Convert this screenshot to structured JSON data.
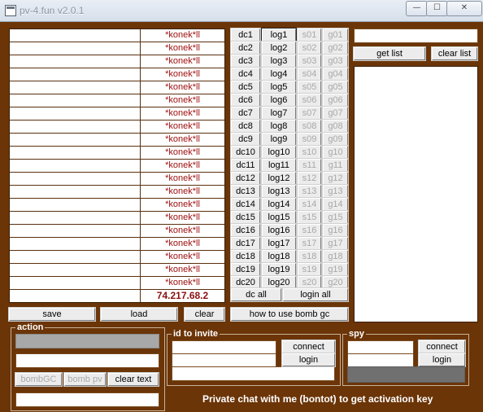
{
  "window": {
    "title": "pv-4.fun v2.0.1",
    "controls": {
      "minimize": "—",
      "maximize": "☐",
      "close": "✕"
    }
  },
  "rooms": {
    "rows": [
      {
        "name": "",
        "tag": "*konek*ll"
      },
      {
        "name": "",
        "tag": "*konek*ll"
      },
      {
        "name": "",
        "tag": "*konek*ll"
      },
      {
        "name": "",
        "tag": "*konek*ll"
      },
      {
        "name": "",
        "tag": "*konek*ll"
      },
      {
        "name": "",
        "tag": "*konek*ll"
      },
      {
        "name": "",
        "tag": "*konek*ll"
      },
      {
        "name": "",
        "tag": "*konek*ll"
      },
      {
        "name": "",
        "tag": "*konek*ll"
      },
      {
        "name": "",
        "tag": "*konek*ll"
      },
      {
        "name": "",
        "tag": "*konek*ll"
      },
      {
        "name": "",
        "tag": "*konek*ll"
      },
      {
        "name": "",
        "tag": "*konek*ll"
      },
      {
        "name": "",
        "tag": "*konek*ll"
      },
      {
        "name": "",
        "tag": "*konek*ll"
      },
      {
        "name": "",
        "tag": "*konek*ll"
      },
      {
        "name": "",
        "tag": "*konek*ll"
      },
      {
        "name": "",
        "tag": "*konek*ll"
      },
      {
        "name": "",
        "tag": "*konek*ll"
      },
      {
        "name": "",
        "tag": "*konek*ll"
      }
    ],
    "ip": "74.217.68.2"
  },
  "session_buttons": [
    {
      "dc": "dc1",
      "log": "log1",
      "s": "s01",
      "g": "g01"
    },
    {
      "dc": "dc2",
      "log": "log2",
      "s": "s02",
      "g": "g02"
    },
    {
      "dc": "dc3",
      "log": "log3",
      "s": "s03",
      "g": "g03"
    },
    {
      "dc": "dc4",
      "log": "log4",
      "s": "s04",
      "g": "g04"
    },
    {
      "dc": "dc5",
      "log": "log5",
      "s": "s05",
      "g": "g05"
    },
    {
      "dc": "dc6",
      "log": "log6",
      "s": "s06",
      "g": "g06"
    },
    {
      "dc": "dc7",
      "log": "log7",
      "s": "s07",
      "g": "g07"
    },
    {
      "dc": "dc8",
      "log": "log8",
      "s": "s08",
      "g": "g08"
    },
    {
      "dc": "dc9",
      "log": "log9",
      "s": "s09",
      "g": "g09"
    },
    {
      "dc": "dc10",
      "log": "log10",
      "s": "s10",
      "g": "g10"
    },
    {
      "dc": "dc11",
      "log": "log11",
      "s": "s11",
      "g": "g11"
    },
    {
      "dc": "dc12",
      "log": "log12",
      "s": "s12",
      "g": "g12"
    },
    {
      "dc": "dc13",
      "log": "log13",
      "s": "s13",
      "g": "g13"
    },
    {
      "dc": "dc14",
      "log": "log14",
      "s": "s14",
      "g": "g14"
    },
    {
      "dc": "dc15",
      "log": "log15",
      "s": "s15",
      "g": "g15"
    },
    {
      "dc": "dc16",
      "log": "log16",
      "s": "s16",
      "g": "g16"
    },
    {
      "dc": "dc17",
      "log": "log17",
      "s": "s17",
      "g": "g17"
    },
    {
      "dc": "dc18",
      "log": "log18",
      "s": "s18",
      "g": "g18"
    },
    {
      "dc": "dc19",
      "log": "log19",
      "s": "s19",
      "g": "g19"
    },
    {
      "dc": "dc20",
      "log": "log20",
      "s": "s20",
      "g": "g20"
    }
  ],
  "bulk": {
    "dc_all": "dc all",
    "login_all": "login all"
  },
  "right": {
    "search_value": "",
    "get_list": "get list",
    "clear_list": "clear list"
  },
  "bottom_buttons": {
    "save": "save",
    "load": "load",
    "clear": "clear",
    "how_to": "how to use bomb gc"
  },
  "action": {
    "legend": "action",
    "field1": "",
    "field2": "",
    "bomb_gc": "bombGC",
    "bomb_pv": "bomb pv",
    "clear_text": "clear text",
    "field3": ""
  },
  "invite": {
    "legend": "id to invite",
    "id_value": "",
    "pass_value": "",
    "msg_value": "",
    "connect": "connect",
    "login": "login"
  },
  "spy": {
    "legend": "spy",
    "id_value": "",
    "pass_value": "",
    "connect": "connect",
    "login": "login"
  },
  "footer_note": "Private chat with me (bontot) to get activation key",
  "colors": {
    "window_bg": "#6b3508",
    "tag_red": "#a01010",
    "disabled_text": "#a8a8a8"
  }
}
